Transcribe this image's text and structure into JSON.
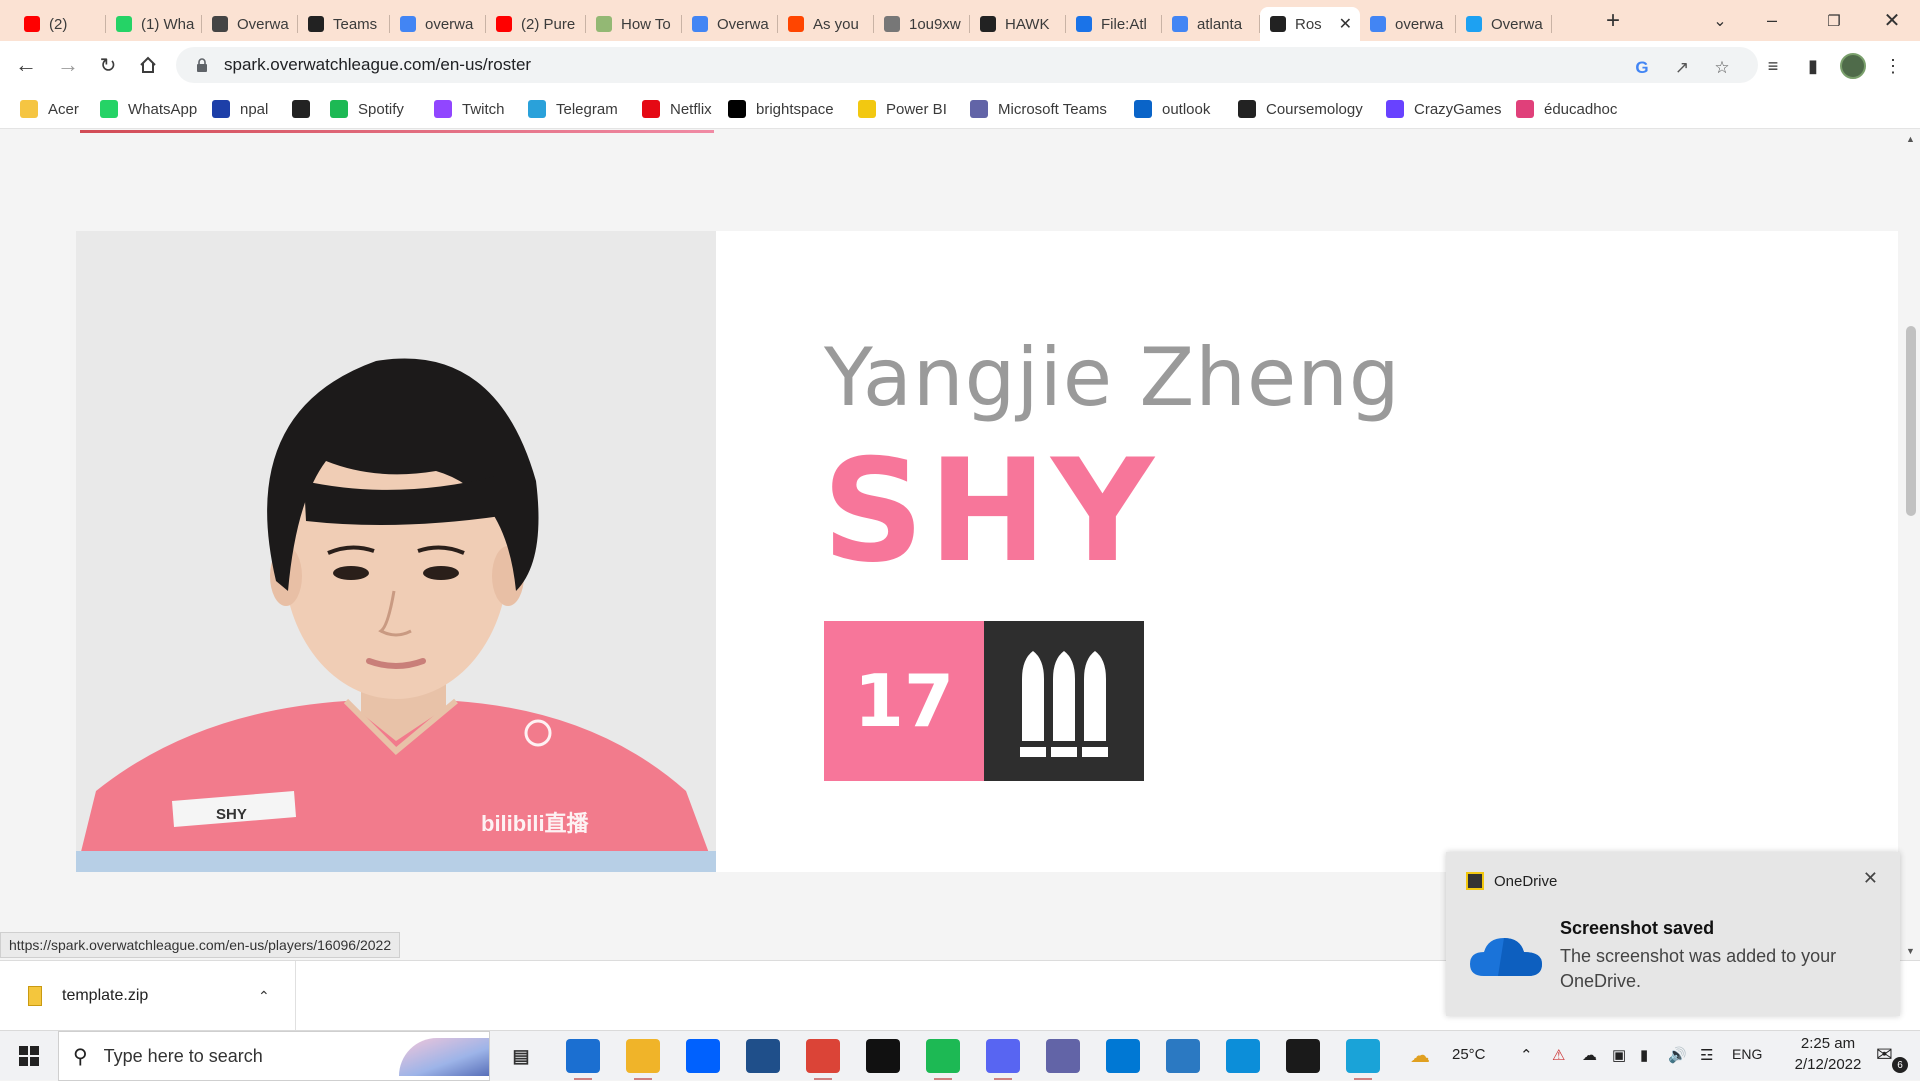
{
  "tabs": [
    {
      "title": "(2)",
      "icon": "youtube-icon",
      "color": "#ff0000"
    },
    {
      "title": "(1) Wha",
      "icon": "whatsapp-icon",
      "color": "#25d366"
    },
    {
      "title": "Overwa",
      "icon": "overwatch-icon",
      "color": "#444444"
    },
    {
      "title": "Teams",
      "icon": "team-logo-icon",
      "color": "#222222"
    },
    {
      "title": "overwa",
      "icon": "google-icon",
      "color": "#4285f4"
    },
    {
      "title": "(2) Pure",
      "icon": "youtube-icon",
      "color": "#ff0000"
    },
    {
      "title": "How To",
      "icon": "wikihow-icon",
      "color": "#93b874"
    },
    {
      "title": "Overwa",
      "icon": "google-icon",
      "color": "#4285f4"
    },
    {
      "title": "As you",
      "icon": "reddit-icon",
      "color": "#ff4500"
    },
    {
      "title": "1ou9xw",
      "icon": "globe-icon",
      "color": "#777777"
    },
    {
      "title": "HAWK",
      "icon": "team-logo-icon",
      "color": "#222222"
    },
    {
      "title": "File:Atl",
      "icon": "wiki-icon",
      "color": "#1a73e8"
    },
    {
      "title": "atlanta",
      "icon": "google-icon",
      "color": "#4285f4"
    },
    {
      "title": "Ros",
      "icon": "team-logo-icon",
      "color": "#222222",
      "active": true
    },
    {
      "title": "overwa",
      "icon": "google-icon",
      "color": "#4285f4"
    },
    {
      "title": "Overwa",
      "icon": "twitter-icon",
      "color": "#1da1f2"
    }
  ],
  "url": "spark.overwatchleague.com/en-us/roster",
  "bookmarks": [
    {
      "label": "Acer",
      "icon": "folder-icon",
      "color": "#f5c542"
    },
    {
      "label": "WhatsApp",
      "icon": "whatsapp-icon",
      "color": "#25d366"
    },
    {
      "label": "npal",
      "icon": "npal-icon",
      "color": "#1d3fa8"
    },
    {
      "label": "",
      "icon": "globe-icon",
      "color": "#222222"
    },
    {
      "label": "Spotify",
      "icon": "spotify-icon",
      "color": "#1db954"
    },
    {
      "label": "Twitch",
      "icon": "twitch-icon",
      "color": "#9146ff"
    },
    {
      "label": "Telegram",
      "icon": "telegram-icon",
      "color": "#2aa1da"
    },
    {
      "label": "Netflix",
      "icon": "netflix-icon",
      "color": "#e50914"
    },
    {
      "label": "brightspace",
      "icon": "np-icon",
      "color": "#000000"
    },
    {
      "label": "Power BI",
      "icon": "powerbi-icon",
      "color": "#f2c811"
    },
    {
      "label": "Microsoft Teams",
      "icon": "teams-icon",
      "color": "#6264a7"
    },
    {
      "label": "outlook",
      "icon": "outlook-icon",
      "color": "#0a64c8"
    },
    {
      "label": "Coursemology",
      "icon": "coursemology-icon",
      "color": "#222222"
    },
    {
      "label": "CrazyGames",
      "icon": "crazygames-icon",
      "color": "#6842ff"
    },
    {
      "label": "éducadhoc",
      "icon": "educadhoc-icon",
      "color": "#e0407a"
    }
  ],
  "player": {
    "real_name": "Yangjie Zheng",
    "handle": "SHY",
    "number": "17",
    "role_icon": "damage-role-icon",
    "jersey_name": "SHY",
    "jersey_sponsor": "bilibili直播",
    "accent": "#f7769a",
    "role_bg": "#2e2e2e"
  },
  "status_url": "https://spark.overwatchleague.com/en-us/players/16096/2022",
  "download": {
    "filename": "template.zip"
  },
  "toast": {
    "app": "OneDrive",
    "title": "Screenshot saved",
    "body": "The screenshot was added to your OneDrive."
  },
  "taskbar": {
    "search_placeholder": "Type here to search",
    "weather": "25°C",
    "lang": "ENG",
    "time": "2:25 am",
    "date": "2/12/2022",
    "notification_count": "6"
  }
}
